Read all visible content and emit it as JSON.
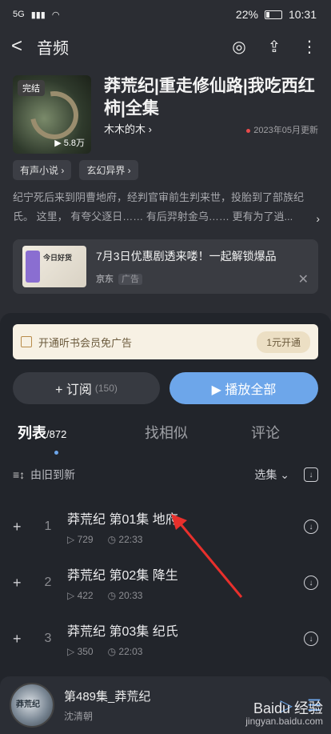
{
  "status_bar": {
    "network": "5G",
    "battery": "22%",
    "time": "10:31"
  },
  "header": {
    "back": "<",
    "title": "音频",
    "icons": [
      "target-icon",
      "share-icon",
      "more-icon"
    ]
  },
  "album": {
    "cover_badge": "完结",
    "cover_plays": "▶ 5.8万",
    "title": "莽荒纪|重走修仙路|我吃西红柿|全集",
    "author": "木木的木 ›",
    "updated": "2023年05月更新"
  },
  "tags": [
    "有声小说 ›",
    "玄幻异界 ›"
  ],
  "description": "纪宁死后来到阴曹地府，经判官审前生判来世，投胎到了部族纪氏。 这里， 有夸父逐日…… 有后羿射金乌…… 更有为了逍...",
  "ad": {
    "title": "7月3日优惠剧透来喽！一起解锁爆品",
    "source": "京东",
    "tag": "广告",
    "image_text": "今日好货"
  },
  "vip": {
    "text": "开通听书会员免广告",
    "button": "1元开通"
  },
  "actions": {
    "subscribe": "+ 订阅",
    "subscribe_count": "(150)",
    "play_all": "▶ 播放全部"
  },
  "tabs": {
    "list": "列表",
    "list_count": "/872",
    "similar": "找相似",
    "comments": "评论"
  },
  "sort": {
    "order": "由旧到新",
    "select": "选集 ⌄"
  },
  "episodes": [
    {
      "num": "1",
      "title": "莽荒纪 第01集  地府",
      "plays": "▷ 729",
      "duration": "◷ 22:33"
    },
    {
      "num": "2",
      "title": "莽荒纪 第02集 降生",
      "plays": "▷ 422",
      "duration": "◷ 20:33"
    },
    {
      "num": "3",
      "title": "莽荒纪 第03集 纪氏",
      "plays": "▷ 350",
      "duration": "◷ 22:03"
    }
  ],
  "player": {
    "title": "第489集_莽荒纪",
    "author": "沈清朝",
    "cover_text": "莽荒纪"
  },
  "watermark": {
    "logo": "Baidu 经验",
    "url": "jingyan.baidu.com"
  }
}
